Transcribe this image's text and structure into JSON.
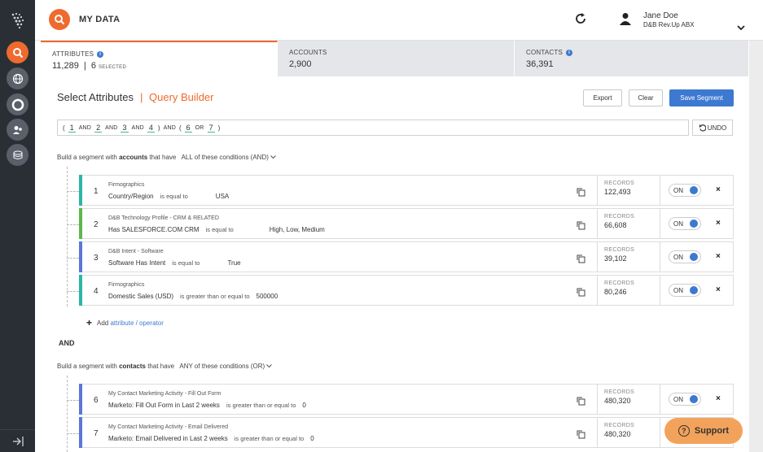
{
  "header": {
    "app_title": "MY DATA",
    "user_name": "Jane Doe",
    "user_org": "D&B Rev.Up ABX"
  },
  "tabs": [
    {
      "label": "ATTRIBUTES",
      "value": "11,289",
      "sep": "|",
      "selected_count": "6",
      "selected_label": "SELECTED"
    },
    {
      "label": "ACCOUNTS",
      "value": "2,900"
    },
    {
      "label": "CONTACTS",
      "value": "36,391"
    }
  ],
  "toolbar": {
    "select_attributes": "Select Attributes",
    "separator": "|",
    "query_builder": "Query Builder",
    "export": "Export",
    "clear": "Clear",
    "save_segment": "Save Segment",
    "undo": "UNDO"
  },
  "expression": {
    "open1": "(",
    "n1": "1",
    "and1": "AND",
    "n2": "2",
    "and2": "AND",
    "n3": "3",
    "and3": "AND",
    "n4": "4",
    "close1": ")",
    "and_mid": "AND",
    "open2": "(",
    "n6": "6",
    "or": "OR",
    "n7": "7",
    "close2": ")"
  },
  "accounts_section": {
    "prefix": "Build a segment with",
    "entity": "accounts",
    "suffix": "that have",
    "condition": "ALL of these conditions (AND)"
  },
  "contacts_section": {
    "prefix": "Build a segment with",
    "entity": "contacts",
    "suffix": "that have",
    "condition": "ANY of these conditions (OR)"
  },
  "records_label": "RECORDS",
  "toggle_label": "ON",
  "delete_label": "×",
  "conditions": [
    {
      "index": "1",
      "category": "Firmographics",
      "attribute": "Country/Region",
      "operator": "is equal to",
      "value": "USA",
      "records": "122,493",
      "color": "#2bb5a8"
    },
    {
      "index": "2",
      "category": "D&B Technology Profile - CRM & RELATED",
      "attribute": "Has SALESFORCE.COM CRM",
      "operator": "is equal to",
      "value": "High, Low, Medium",
      "records": "66,608",
      "color": "#5db84a"
    },
    {
      "index": "3",
      "category": "D&B Intent - Software",
      "attribute": "Software Has Intent",
      "operator": "is equal to",
      "value": "True",
      "records": "39,102",
      "color": "#5b76d6"
    },
    {
      "index": "4",
      "category": "Firmographics",
      "attribute": "Domestic Sales (USD)",
      "operator": "is greater than or equal to",
      "value": "500000",
      "records": "80,246",
      "color": "#2bb5a8"
    },
    {
      "index": "6",
      "category": "My Contact Marketing Activity - Fill Out Form",
      "attribute": "Marketo: Fill Out Form in Last 2 weeks",
      "operator": "is greater than or equal to",
      "value": "0",
      "records": "480,320",
      "color": "#5b76d6"
    },
    {
      "index": "7",
      "category": "My Contact Marketing Activity - Email Delivered",
      "attribute": "Marketo: Email Delivered in Last 2 weeks",
      "operator": "is greater than or equal to",
      "value": "0",
      "records": "480,320",
      "color": "#5b76d6"
    }
  ],
  "add_row": {
    "prefix": "Add",
    "link": "attribute / operator"
  },
  "and_label": "AND",
  "support": {
    "label": "Support",
    "icon": "?"
  },
  "colors": {
    "accent": "#ef6a2e",
    "primary": "#3d79d0"
  }
}
